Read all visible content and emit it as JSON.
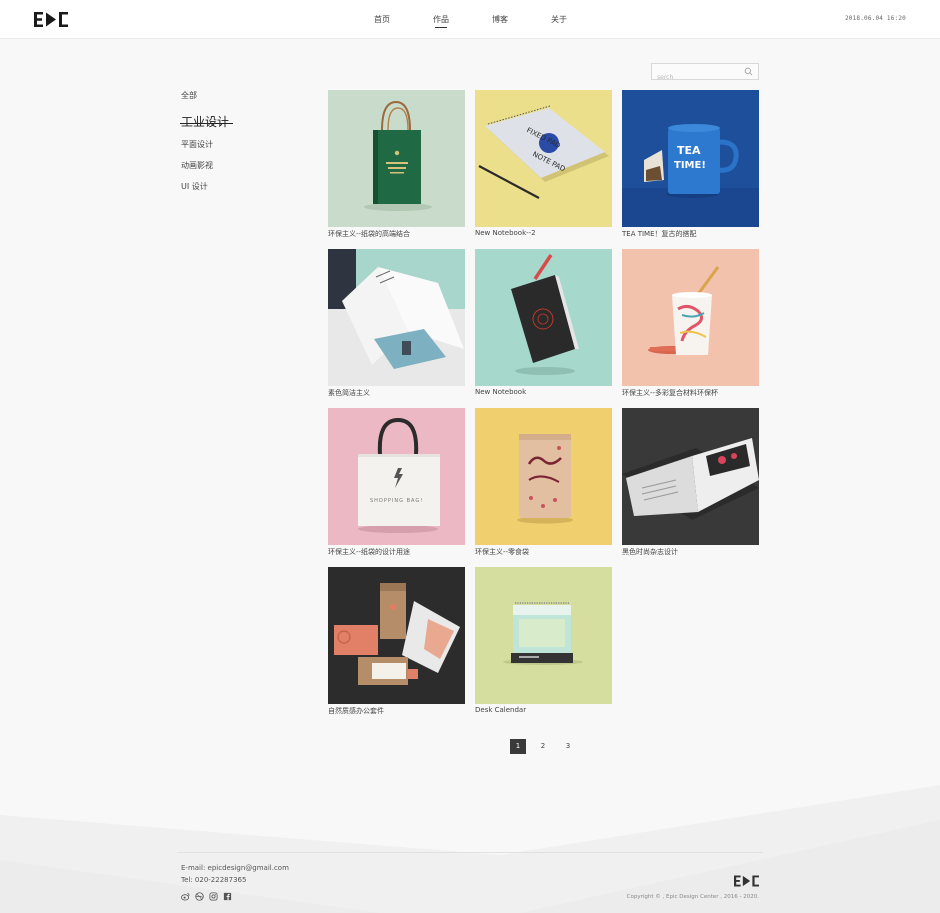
{
  "header": {
    "logo_text": "E▶C",
    "nav": [
      {
        "label": "首页",
        "active": false
      },
      {
        "label": "作品",
        "active": true
      },
      {
        "label": "博客",
        "active": false
      },
      {
        "label": "关于",
        "active": false
      }
    ],
    "datetime": "2018.06.04  16:20"
  },
  "search": {
    "placeholder": "serch",
    "value": "",
    "icon": "search-icon"
  },
  "sidebar": {
    "items": [
      {
        "label": "全部",
        "active": false
      },
      {
        "label": "工业设计",
        "active": true
      },
      {
        "label": "平面设计",
        "active": false
      },
      {
        "label": "动画影视",
        "active": false
      },
      {
        "label": "UI 设计",
        "active": false
      }
    ]
  },
  "works": [
    {
      "caption": "环保主义--纸袋的高端结合",
      "bg": "#c9dccb"
    },
    {
      "caption": "New Notebook--2",
      "bg": "#ecdf8c"
    },
    {
      "caption": "TEA TIME！复古的搭配",
      "bg": "#1e4f9a"
    },
    {
      "caption": "素色简洁主义",
      "bg": "#e9e9e9"
    },
    {
      "caption": "New Notebook",
      "bg": "#a7d8cc"
    },
    {
      "caption": "环保主义--多彩复合材料环保杯",
      "bg": "#f2c2ad"
    },
    {
      "caption": "环保主义--纸袋的设计用途",
      "bg": "#ecb8c4"
    },
    {
      "caption": "环保主义--零食袋",
      "bg": "#efcf6e"
    },
    {
      "caption": "黑色时尚杂志设计",
      "bg": "#393939"
    },
    {
      "caption": "自然质感办公套件",
      "bg": "#2c2c2c"
    },
    {
      "caption": "Desk Calendar",
      "bg": "#d5dd9f"
    }
  ],
  "pagination": {
    "pages": [
      "1",
      "2",
      "3"
    ],
    "current": "1"
  },
  "footer": {
    "email": "E-mail: epicdesign@gmail.com",
    "tel": "Tel: 020-22287365",
    "socials": [
      "weibo-icon",
      "dribbble-icon",
      "instagram-icon",
      "facebook-icon"
    ],
    "copyright": "Copyright © , Epic Design Center , 2016 - 2020."
  }
}
